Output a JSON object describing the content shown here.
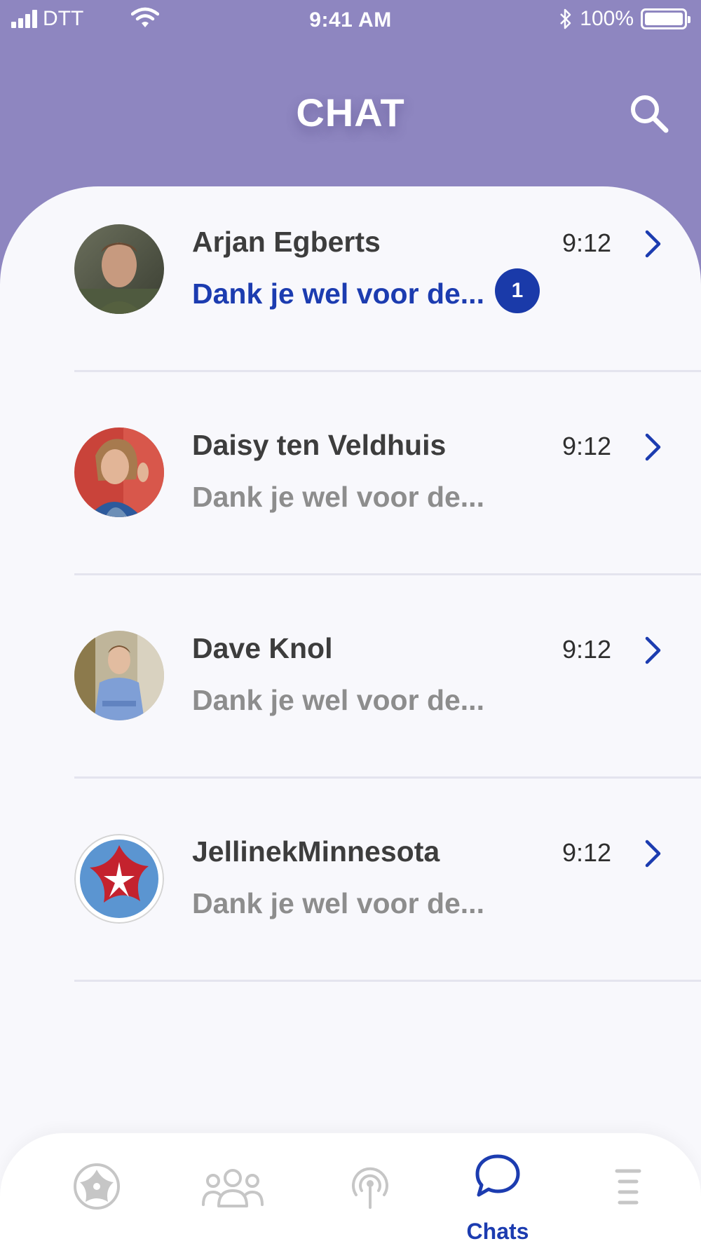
{
  "status_bar": {
    "carrier": "DTT",
    "time": "9:41 AM",
    "battery": "100%"
  },
  "header": {
    "title": "CHAT"
  },
  "chats": [
    {
      "name": "Arjan Egberts",
      "preview": "Dank je wel voor de...",
      "time": "9:12",
      "unread": "1"
    },
    {
      "name": "Daisy ten Veldhuis",
      "preview": "Dank je wel voor de...",
      "time": "9:12"
    },
    {
      "name": "Dave Knol",
      "preview": "Dank je wel voor de...",
      "time": "9:12"
    },
    {
      "name": "JellinekMinnesota",
      "preview": "Dank je wel voor de...",
      "time": "9:12"
    }
  ],
  "tabbar": {
    "tabs": [
      {
        "icon": "flower-logo-icon"
      },
      {
        "icon": "group-icon"
      },
      {
        "icon": "broadcast-icon"
      },
      {
        "icon": "chat-bubble-icon",
        "label": "Chats",
        "active": true
      },
      {
        "icon": "menu-icon"
      }
    ]
  },
  "colors": {
    "header_bg": "#8e86c0",
    "accent": "#1c3cb0",
    "card_bg": "#f8f8fc",
    "inactive_icon": "#c6c6c6"
  }
}
